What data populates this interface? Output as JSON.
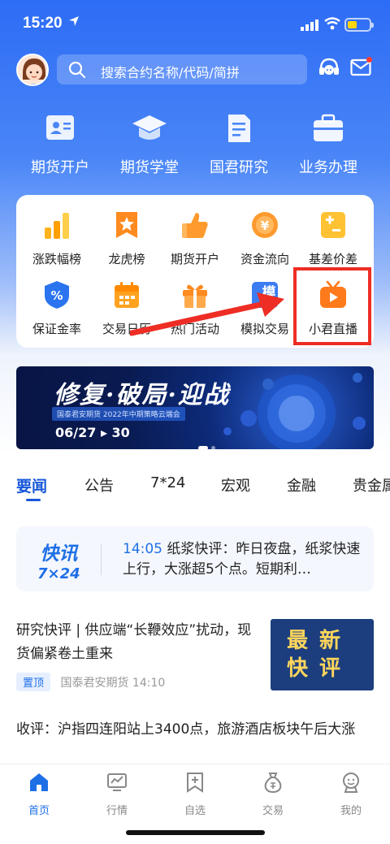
{
  "status_bar": {
    "time": "15:20"
  },
  "search": {
    "placeholder": "搜索合约名称/代码/简拼"
  },
  "top_menu": [
    {
      "label": "期货开户",
      "icon": "id-card-icon"
    },
    {
      "label": "期货学堂",
      "icon": "graduation-cap-icon"
    },
    {
      "label": "国君研究",
      "icon": "document-icon"
    },
    {
      "label": "业务办理",
      "icon": "briefcase-icon"
    }
  ],
  "quick_grid": [
    {
      "label": "涨跌幅榜",
      "icon": "bar-chart-icon"
    },
    {
      "label": "龙虎榜",
      "icon": "star-badge-icon"
    },
    {
      "label": "期货开户",
      "icon": "thumbs-up-icon"
    },
    {
      "label": "资金流向",
      "icon": "yuan-coin-icon"
    },
    {
      "label": "基差价差",
      "icon": "plus-minus-icon"
    },
    {
      "label": "保证金率",
      "icon": "percent-shield-icon"
    },
    {
      "label": "交易日历",
      "icon": "calendar-icon"
    },
    {
      "label": "热门活动",
      "icon": "gift-icon"
    },
    {
      "label": "模拟交易",
      "icon": "simulation-icon",
      "glyph": "模"
    },
    {
      "label": "小君直播",
      "icon": "tv-play-icon"
    }
  ],
  "banner": {
    "title": "修复·破局·迎战",
    "subtitle": "国泰君安期货  2022年中期策略云端会",
    "date": "06/27 ▸ 30"
  },
  "news_tabs": [
    "要闻",
    "公告",
    "7*24",
    "宏观",
    "金融",
    "贵金属"
  ],
  "flash": {
    "logo_line1": "快讯",
    "logo_line2": "7×24",
    "time": "14:05",
    "text": "纸浆快评：昨日夜盘，纸浆快速上行，大涨超5个点。短期利…"
  },
  "articles": [
    {
      "title": "研究快评 | 供应端“长鞭效应”扰动，现货偏紧卷土重来",
      "badge": "置顶",
      "source": "国泰君安期货",
      "time": "14:10",
      "thumb_text": "最新快评"
    },
    {
      "title": "收评：沪指四连阳站上3400点，旅游酒店板块午后大涨"
    }
  ],
  "bottom_nav": [
    {
      "label": "首页",
      "icon": "home-icon",
      "active": true
    },
    {
      "label": "行情",
      "icon": "market-chart-icon"
    },
    {
      "label": "自选",
      "icon": "favorites-plus-icon"
    },
    {
      "label": "交易",
      "icon": "money-bag-icon"
    },
    {
      "label": "我的",
      "icon": "profile-icon"
    }
  ],
  "colors": {
    "brand_blue": "#1e6fe6",
    "highlight_red": "#ee2d24"
  }
}
